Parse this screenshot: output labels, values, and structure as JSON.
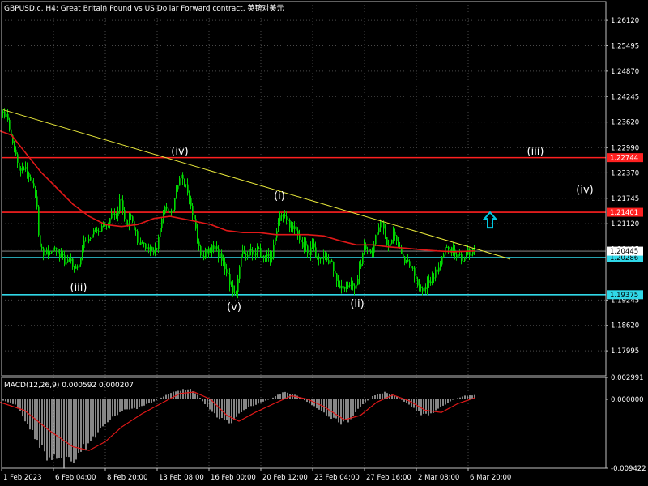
{
  "header": {
    "title": "GBPUSD.c, H4:  Great Britain Pound vs US Dollar Forward contract, 英镑对美元"
  },
  "colors": {
    "background": "#000000",
    "frame": "#c0c0c0",
    "grid": "#4a4a4a",
    "candle": "#00d800",
    "moving_average": "#e01818",
    "trendline": "#e8e83a",
    "resistance": "#ff2020",
    "support": "#30d8e8",
    "arrow": "#00c8e0",
    "macd_hist": "#c0c0c0",
    "macd_signal": "#e01818",
    "label_text": "#ffffff",
    "current_price_bg": "#ffffff"
  },
  "chart_data": [
    {
      "type": "candlestick",
      "symbol": "GBPUSD.c",
      "timeframe": "H4",
      "ylim": [
        1.1738,
        1.2658
      ],
      "y_ticks": [
        "1.26120",
        "1.25495",
        "1.24870",
        "1.24245",
        "1.23620",
        "1.22990",
        "1.22370",
        "1.21745",
        "1.21120",
        "1.20495",
        "1.19245",
        "1.18620",
        "1.17995"
      ],
      "x_ticks": [
        "1 Feb 2023",
        "6 Feb 04:00",
        "8 Feb 20:00",
        "13 Feb 08:00",
        "16 Feb 00:00",
        "20 Feb 12:00",
        "23 Feb 04:00",
        "27 Feb 16:00",
        "2 Mar 08:00",
        "6 Mar 20:00"
      ],
      "price_path": [
        [
          0,
          1.239
        ],
        [
          8,
          1.237
        ],
        [
          12,
          1.234
        ],
        [
          18,
          1.229
        ],
        [
          24,
          1.224
        ],
        [
          32,
          1.225
        ],
        [
          40,
          1.22
        ],
        [
          44,
          1.218
        ],
        [
          48,
          1.206
        ],
        [
          52,
          1.204
        ],
        [
          56,
          1.204
        ],
        [
          62,
          1.203
        ],
        [
          66,
          1.2055
        ],
        [
          70,
          1.204
        ],
        [
          76,
          1.203
        ],
        [
          80,
          1.2015
        ],
        [
          86,
          1.203
        ],
        [
          90,
          1.2
        ],
        [
          96,
          1.1995
        ],
        [
          100,
          1.204
        ],
        [
          104,
          1.208
        ],
        [
          108,
          1.206
        ],
        [
          114,
          1.21
        ],
        [
          118,
          1.209
        ],
        [
          124,
          1.209
        ],
        [
          128,
          1.212
        ],
        [
          132,
          1.211
        ],
        [
          138,
          1.214
        ],
        [
          144,
          1.213
        ],
        [
          148,
          1.218
        ],
        [
          152,
          1.213
        ],
        [
          156,
          1.211
        ],
        [
          160,
          1.213
        ],
        [
          166,
          1.21
        ],
        [
          170,
          1.206
        ],
        [
          174,
          1.207
        ],
        [
          180,
          1.205
        ],
        [
          186,
          1.206
        ],
        [
          190,
          1.204
        ],
        [
          194,
          1.206
        ],
        [
          198,
          1.211
        ],
        [
          204,
          1.216
        ],
        [
          210,
          1.214
        ],
        [
          214,
          1.216
        ],
        [
          218,
          1.22
        ],
        [
          222,
          1.224
        ],
        [
          226,
          1.222
        ],
        [
          232,
          1.218
        ],
        [
          236,
          1.215
        ],
        [
          240,
          1.211
        ],
        [
          244,
          1.206
        ],
        [
          248,
          1.202
        ],
        [
          254,
          1.205
        ],
        [
          258,
          1.204
        ],
        [
          264,
          1.206
        ],
        [
          268,
          1.204
        ],
        [
          272,
          1.203
        ],
        [
          276,
          1.201
        ],
        [
          280,
          1.199
        ],
        [
          284,
          1.196
        ],
        [
          290,
          1.1935
        ],
        [
          294,
          1.199
        ],
        [
          298,
          1.205
        ],
        [
          302,
          1.203
        ],
        [
          308,
          1.205
        ],
        [
          312,
          1.204
        ],
        [
          318,
          1.205
        ],
        [
          322,
          1.203
        ],
        [
          328,
          1.204
        ],
        [
          334,
          1.203
        ],
        [
          338,
          1.206
        ],
        [
          342,
          1.21
        ],
        [
          346,
          1.214
        ],
        [
          350,
          1.213
        ],
        [
          354,
          1.212
        ],
        [
          358,
          1.21
        ],
        [
          362,
          1.211
        ],
        [
          366,
          1.209
        ],
        [
          372,
          1.206
        ],
        [
          376,
          1.207
        ],
        [
          380,
          1.204
        ],
        [
          386,
          1.206
        ],
        [
          390,
          1.203
        ],
        [
          394,
          1.202
        ],
        [
          400,
          1.203
        ],
        [
          404,
          1.202
        ],
        [
          410,
          1.201
        ],
        [
          414,
          1.198
        ],
        [
          418,
          1.196
        ],
        [
          422,
          1.1955
        ],
        [
          426,
          1.196
        ],
        [
          430,
          1.195
        ],
        [
          434,
          1.196
        ],
        [
          438,
          1.195
        ],
        [
          442,
          1.199
        ],
        [
          446,
          1.203
        ],
        [
          450,
          1.206
        ],
        [
          454,
          1.205
        ],
        [
          458,
          1.204
        ],
        [
          462,
          1.207
        ],
        [
          466,
          1.209
        ],
        [
          470,
          1.212
        ],
        [
          474,
          1.21
        ],
        [
          478,
          1.205
        ],
        [
          482,
          1.207
        ],
        [
          486,
          1.209
        ],
        [
          490,
          1.206
        ],
        [
          494,
          1.204
        ],
        [
          498,
          1.202
        ],
        [
          502,
          1.203
        ],
        [
          506,
          1.201
        ],
        [
          510,
          1.199
        ],
        [
          514,
          1.197
        ],
        [
          518,
          1.195
        ],
        [
          522,
          1.1945
        ],
        [
          526,
          1.196
        ],
        [
          530,
          1.1975
        ],
        [
          534,
          1.198
        ],
        [
          538,
          1.2
        ],
        [
          542,
          1.201
        ],
        [
          546,
          1.204
        ],
        [
          550,
          1.205
        ],
        [
          554,
          1.204
        ],
        [
          558,
          1.205
        ],
        [
          562,
          1.203
        ],
        [
          566,
          1.204
        ],
        [
          570,
          1.202
        ],
        [
          574,
          1.204
        ],
        [
          578,
          1.204
        ],
        [
          584,
          1.205
        ]
      ],
      "moving_average_path": [
        [
          0,
          1.234
        ],
        [
          14,
          1.233
        ],
        [
          30,
          1.229
        ],
        [
          50,
          1.224
        ],
        [
          70,
          1.22
        ],
        [
          90,
          1.216
        ],
        [
          110,
          1.213
        ],
        [
          130,
          1.211
        ],
        [
          150,
          1.2105
        ],
        [
          170,
          1.211
        ],
        [
          190,
          1.2125
        ],
        [
          210,
          1.213
        ],
        [
          236,
          1.212
        ],
        [
          260,
          1.211
        ],
        [
          280,
          1.2095
        ],
        [
          300,
          1.209
        ],
        [
          320,
          1.209
        ],
        [
          340,
          1.2085
        ],
        [
          360,
          1.2085
        ],
        [
          380,
          1.2085
        ],
        [
          400,
          1.2082
        ],
        [
          420,
          1.207
        ],
        [
          440,
          1.206
        ],
        [
          460,
          1.206
        ],
        [
          480,
          1.2055
        ],
        [
          500,
          1.2052
        ],
        [
          520,
          1.2048
        ],
        [
          540,
          1.2045
        ],
        [
          560,
          1.2043
        ],
        [
          586,
          1.2045
        ]
      ],
      "trendline": [
        [
          4,
          1.2392
        ],
        [
          630,
          1.2025
        ]
      ],
      "horizontal_levels": [
        {
          "price": 1.22744,
          "label": "1.22744",
          "role": "resistance"
        },
        {
          "price": 1.21401,
          "label": "1.21401",
          "role": "resistance"
        },
        {
          "price": 1.20286,
          "label": "1.20286",
          "role": "support"
        },
        {
          "price": 1.19375,
          "label": "1.19375",
          "role": "support"
        }
      ],
      "current_price": {
        "price": 1.20445,
        "label": "1.20445"
      },
      "wave_labels": [
        {
          "text": "(iii)",
          "x": 97,
          "price": 1.1955
        },
        {
          "text": "(iv)",
          "x": 222,
          "price": 1.229
        },
        {
          "text": "(v)",
          "x": 289,
          "price": 1.1907
        },
        {
          "text": "(i)",
          "x": 345,
          "price": 1.218
        },
        {
          "text": "(ii)",
          "x": 441,
          "price": 1.1915
        },
        {
          "text": "(iii)",
          "x": 661,
          "price": 1.229
        },
        {
          "text": "(iv)",
          "x": 722,
          "price": 1.2195
        }
      ],
      "arrow": {
        "direction": "up",
        "x": 605,
        "price": 1.212
      }
    },
    {
      "type": "bar",
      "indicator": "MACD",
      "title": "MACD(12,26,9) 0.000592 0.000207",
      "ylim": [
        -0.009422,
        0.002991
      ],
      "y_ticks": [
        "0.002991",
        "0.000000",
        "-0.009422"
      ],
      "histogram_path": [
        [
          0,
          0.0
        ],
        [
          20,
          -0.0008
        ],
        [
          40,
          -0.0045
        ],
        [
          60,
          -0.008
        ],
        [
          75,
          -0.0088
        ],
        [
          90,
          -0.0082
        ],
        [
          110,
          -0.006
        ],
        [
          130,
          -0.0035
        ],
        [
          150,
          -0.0015
        ],
        [
          170,
          -0.0012
        ],
        [
          190,
          -0.0003
        ],
        [
          205,
          0.0006
        ],
        [
          220,
          0.0012
        ],
        [
          234,
          0.0014
        ],
        [
          245,
          0.0005
        ],
        [
          255,
          -0.001
        ],
        [
          270,
          -0.0025
        ],
        [
          285,
          -0.0032
        ],
        [
          300,
          -0.0015
        ],
        [
          320,
          -0.0005
        ],
        [
          335,
          0.0001
        ],
        [
          350,
          0.001
        ],
        [
          365,
          0.0006
        ],
        [
          380,
          -0.0004
        ],
        [
          400,
          -0.0018
        ],
        [
          420,
          -0.0032
        ],
        [
          432,
          -0.0028
        ],
        [
          445,
          -0.001
        ],
        [
          460,
          0.0004
        ],
        [
          475,
          0.001
        ],
        [
          490,
          0.0004
        ],
        [
          505,
          -0.0008
        ],
        [
          520,
          -0.002
        ],
        [
          530,
          -0.0022
        ],
        [
          545,
          -0.001
        ],
        [
          560,
          0.0
        ],
        [
          575,
          0.0005
        ],
        [
          586,
          0.0006
        ]
      ],
      "signal_path": [
        [
          0,
          -0.0004
        ],
        [
          30,
          -0.0015
        ],
        [
          60,
          -0.0042
        ],
        [
          90,
          -0.0065
        ],
        [
          110,
          -0.007
        ],
        [
          130,
          -0.0058
        ],
        [
          150,
          -0.0038
        ],
        [
          175,
          -0.002
        ],
        [
          200,
          -0.0005
        ],
        [
          222,
          0.0008
        ],
        [
          240,
          0.001
        ],
        [
          260,
          0.0
        ],
        [
          280,
          -0.0022
        ],
        [
          295,
          -0.003
        ],
        [
          315,
          -0.0018
        ],
        [
          340,
          -0.0005
        ],
        [
          360,
          0.0005
        ],
        [
          380,
          0.0
        ],
        [
          400,
          -0.001
        ],
        [
          425,
          -0.0028
        ],
        [
          445,
          -0.0022
        ],
        [
          465,
          -0.0004
        ],
        [
          485,
          0.0006
        ],
        [
          505,
          -0.0002
        ],
        [
          525,
          -0.0015
        ],
        [
          545,
          -0.0018
        ],
        [
          565,
          -0.0006
        ],
        [
          586,
          0.0002
        ]
      ]
    }
  ]
}
